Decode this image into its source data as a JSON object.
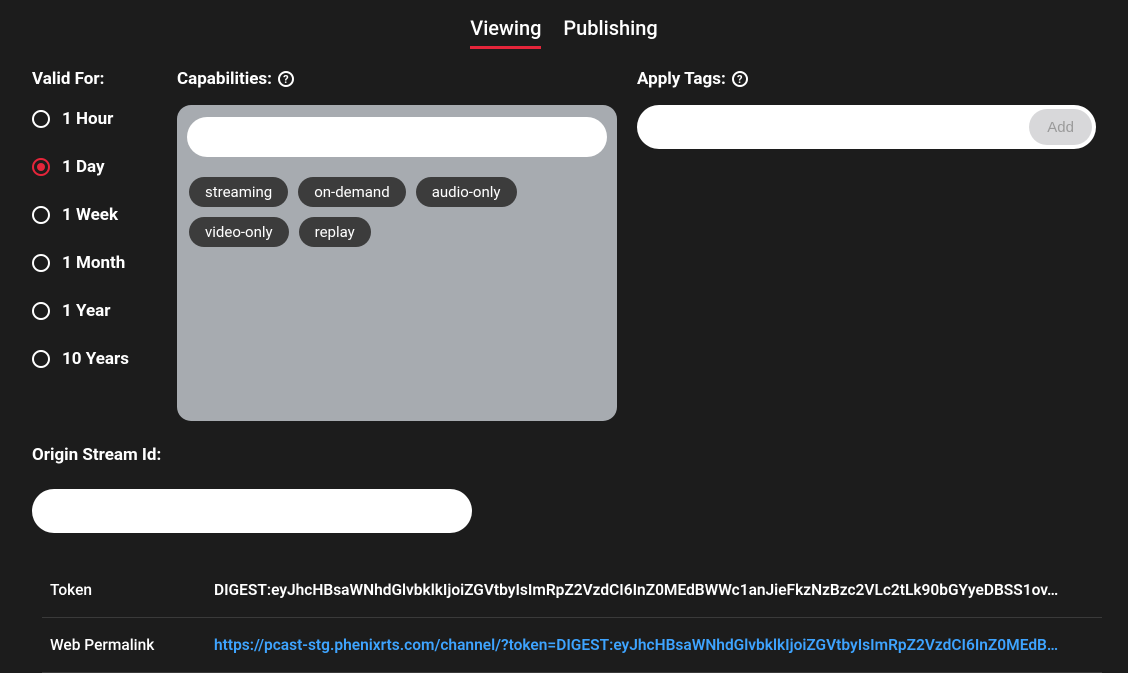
{
  "tabs": {
    "viewing": "Viewing",
    "publishing": "Publishing",
    "active": "viewing"
  },
  "validFor": {
    "label": "Valid For:",
    "options": [
      {
        "label": "1 Hour",
        "selected": false
      },
      {
        "label": "1 Day",
        "selected": true
      },
      {
        "label": "1 Week",
        "selected": false
      },
      {
        "label": "1 Month",
        "selected": false
      },
      {
        "label": "1 Year",
        "selected": false
      },
      {
        "label": "10 Years",
        "selected": false
      }
    ]
  },
  "capabilities": {
    "label": "Capabilities:",
    "input": "",
    "chips": [
      "streaming",
      "on-demand",
      "audio-only",
      "video-only",
      "replay"
    ]
  },
  "tags": {
    "label": "Apply Tags:",
    "input": "",
    "addLabel": "Add"
  },
  "origin": {
    "label": "Origin Stream Id:",
    "value": ""
  },
  "kv": {
    "tokenLabel": "Token",
    "tokenValue": "DIGEST:eyJhcHBsaWNhdGlvbklkIjoiZGVtbyIsImRpZ2VzdCI6InZ0MEdBWWc1anJieFkzNzBzc2VLc2tLk90bGYyeDBSS1ov…",
    "linkLabel": "Web Permalink",
    "linkValue": "https://pcast-stg.phenixrts.com/channel/?token=DIGEST:eyJhcHBsaWNhdGlvbklkIjoiZGVtbyIsImRpZ2VzdCI6InZ0MEdB…"
  }
}
